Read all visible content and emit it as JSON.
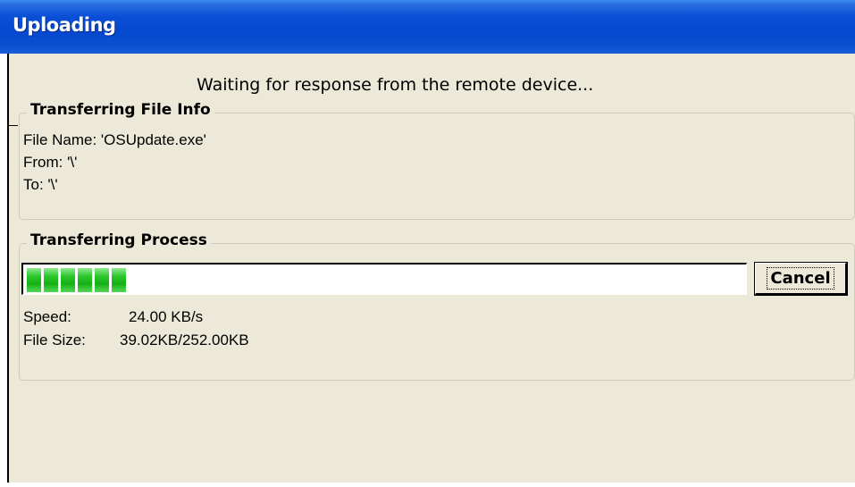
{
  "window": {
    "title": "Uploading",
    "titlebar_color": "#0a4fd6",
    "client_background": "#ece9d8"
  },
  "status_message": "Waiting for response from the remote device...",
  "file_info": {
    "legend": "Transferring File Info",
    "file_name": "File Name: 'OSUpdate.exe'",
    "from": "From: '\\'",
    "to": "To: '\\'"
  },
  "process": {
    "legend": "Transferring Process",
    "progress_fraction": 0.155,
    "progress_color": "#29c629",
    "cancel_label": "Cancel",
    "speed_label": "Speed:",
    "speed_value": "24.00 KB/s",
    "size_label": "File Size:",
    "size_value": "39.02KB/252.00KB"
  }
}
